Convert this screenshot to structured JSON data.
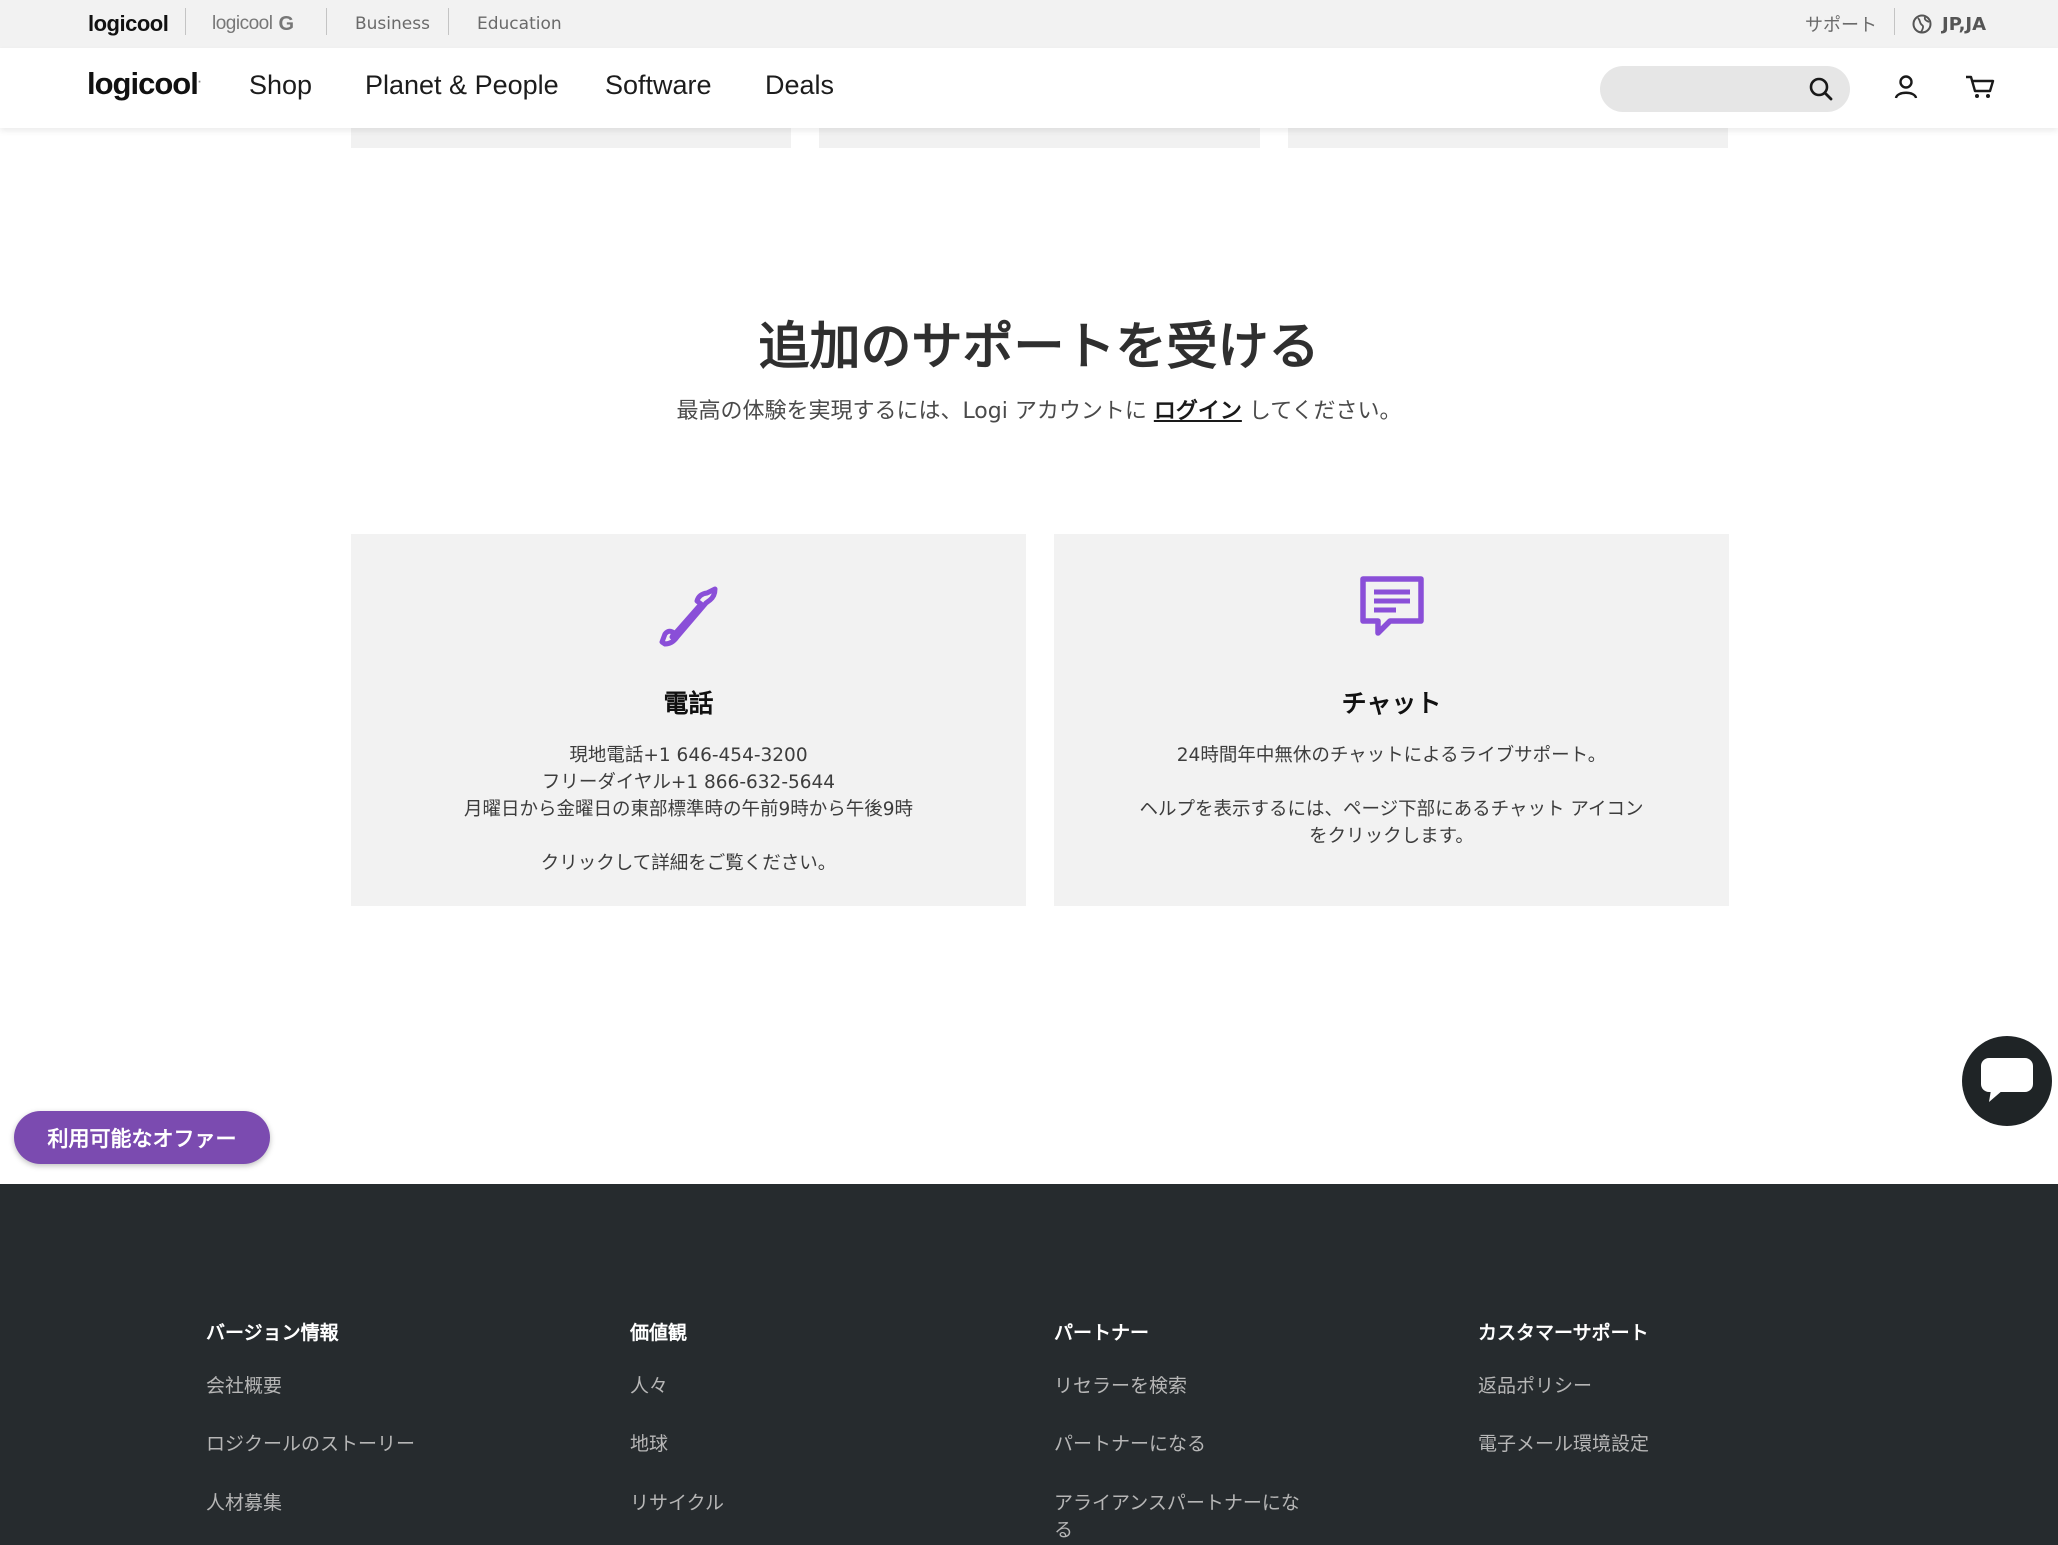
{
  "topbar": {
    "brand_logicool": "logicool",
    "brand_logicool_g": "logicool",
    "brand_g_mark": "G",
    "business": "Business",
    "education": "Education",
    "support": "サポート",
    "locale": "JP,JA"
  },
  "nav": {
    "logo": "logicool",
    "items": [
      "Shop",
      "Planet & People",
      "Software",
      "Deals"
    ],
    "search_placeholder": ""
  },
  "section": {
    "heading": "追加のサポートを受ける",
    "sub_before": "最高の体験を実現するには、Logi アカウントに ",
    "sub_link": "ログイン",
    "sub_after": " してください。"
  },
  "cards": [
    {
      "icon": "phone-icon",
      "title": "電話",
      "lines": [
        "現地電話+1 646-454-3200",
        "フリーダイヤル+1 866-632-5644",
        "月曜日から金曜日の東部標準時の午前9時から午後9時",
        "",
        "クリックして詳細をご覧ください。"
      ]
    },
    {
      "icon": "chat-icon",
      "title": "チャット",
      "lines": [
        "24時間年中無休のチャットによるライブサポート。",
        "",
        "ヘルプを表示するには、ページ下部にあるチャット アイコン をクリックします。"
      ]
    }
  ],
  "offers_button": "利用可能なオファー",
  "footer": {
    "columns": [
      {
        "heading": "バージョン情報",
        "links": [
          "会社概要",
          "ロジクールのストーリー",
          "人材募集"
        ]
      },
      {
        "heading": "価値観",
        "links": [
          "人々",
          "地球",
          "リサイクル"
        ]
      },
      {
        "heading": "パートナー",
        "links": [
          "リセラーを検索",
          "パートナーになる",
          "アライアンスパートナーになる"
        ]
      },
      {
        "heading": "カスタマーサポート",
        "links": [
          "返品ポリシー",
          "電子メール環境設定"
        ]
      }
    ]
  },
  "colors": {
    "accent_purple": "#7b4bb0",
    "icon_purple": "#8a4fd8",
    "footer_bg": "#262b2e",
    "card_bg": "#f2f2f2"
  }
}
